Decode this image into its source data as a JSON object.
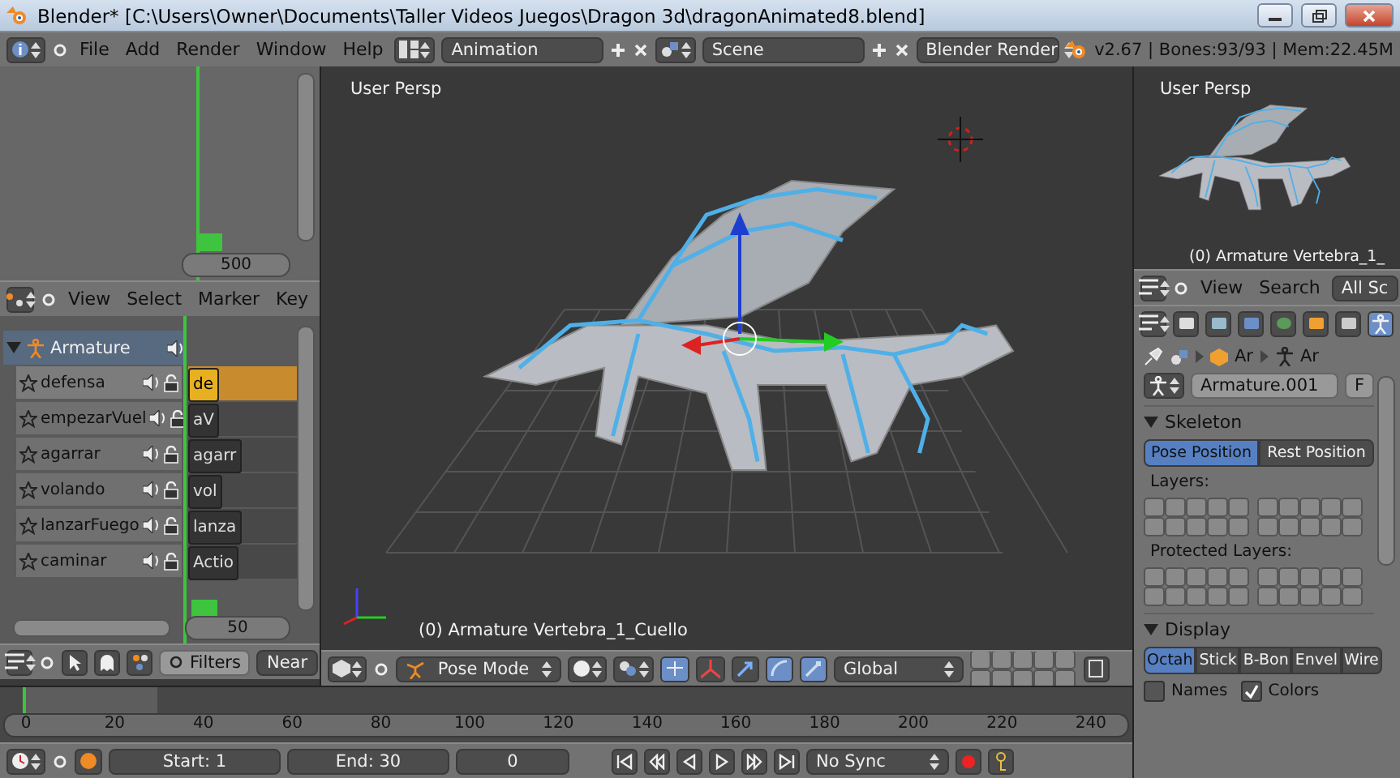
{
  "window": {
    "title": "Blender* [C:\\Users\\Owner\\Documents\\Taller Videos Juegos\\Dragon 3d\\dragonAnimated8.blend]"
  },
  "info_header": {
    "menus": [
      "File",
      "Add",
      "Render",
      "Window",
      "Help"
    ],
    "screen_layout": "Animation",
    "scene": "Scene",
    "render_engine": "Blender Render",
    "stats": "v2.67 | Bones:93/93 | Mem:22.45M"
  },
  "dopesheet": {
    "frame_field": "500",
    "menus": [
      "View",
      "Select",
      "Marker",
      "Key"
    ]
  },
  "nla": {
    "object": {
      "name": "Armature",
      "expanded": true
    },
    "tracks": [
      {
        "name": "defensa",
        "strip": "de",
        "selected": true
      },
      {
        "name": "empezarVuel",
        "strip": "aV",
        "selected": false
      },
      {
        "name": "agarrar",
        "strip": "agarr",
        "selected": false
      },
      {
        "name": "volando",
        "strip": "vol",
        "selected": false
      },
      {
        "name": "lanzarFuego",
        "strip": "lanza",
        "selected": false
      },
      {
        "name": "caminar",
        "strip": "Actio",
        "selected": false
      }
    ],
    "frame_field": "50",
    "filters": "Filters",
    "near": "Near"
  },
  "viewport": {
    "view_label": "User Persp",
    "selection_label": "(0) Armature Vertebra_1_Cuello",
    "mode": "Pose Mode",
    "orientation": "Global"
  },
  "timeline": {
    "ticks": [
      "0",
      "20",
      "40",
      "60",
      "80",
      "100",
      "120",
      "140",
      "160",
      "180",
      "200",
      "220",
      "240"
    ],
    "start": "Start: 1",
    "end": "End: 30",
    "current": "0",
    "sync": "No Sync"
  },
  "mini_viewport": {
    "view_label": "User Persp",
    "selection_label": "(0) Armature Vertebra_1_"
  },
  "outliner": {
    "menus": [
      "View",
      "Search"
    ],
    "filter": "All Sc"
  },
  "properties": {
    "tabs": [
      {
        "selected": false
      },
      {
        "selected": false
      },
      {
        "selected": false
      },
      {
        "selected": false
      },
      {
        "selected": false
      },
      {
        "selected": false
      },
      {
        "selected": true
      }
    ],
    "breadcrumbs": [
      "Ar",
      "Ar"
    ],
    "datablock": "Armature.001",
    "fake_user": "F",
    "skeleton": {
      "title": "Skeleton",
      "expanded": true,
      "positions": [
        {
          "label": "Pose Position",
          "selected": true
        },
        {
          "label": "Rest Position",
          "selected": false
        }
      ],
      "layers_label": "Layers:",
      "protected_label": "Protected Layers:"
    },
    "display": {
      "title": "Display",
      "expanded": true,
      "types": [
        {
          "label": "Octah",
          "selected": true
        },
        {
          "label": "Stick",
          "selected": false
        },
        {
          "label": "B-Bon",
          "selected": false
        },
        {
          "label": "Envel",
          "selected": false
        },
        {
          "label": "Wire",
          "selected": false
        }
      ],
      "options": [
        {
          "label": "Names",
          "checked": false
        },
        {
          "label": "Colors",
          "checked": true
        }
      ]
    }
  }
}
